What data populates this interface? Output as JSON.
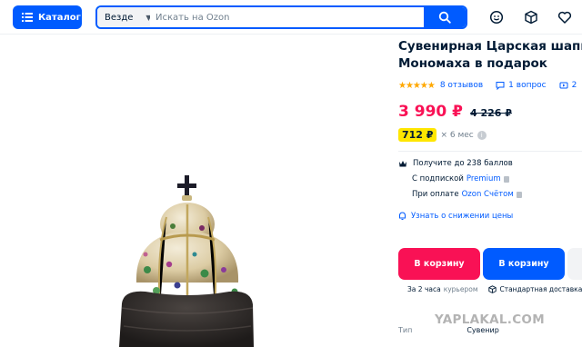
{
  "header": {
    "catalog_label": "Каталог",
    "search_scope": "Везде",
    "search_placeholder": "Искать на Ozon"
  },
  "product": {
    "title_line1": "Сувенирная Царская шапка",
    "title_line2": "Мономаха в подарок",
    "rating_stars": "★★★★★",
    "reviews": "8 отзывов",
    "questions": "1 вопрос",
    "more": "2",
    "price": "3 990 ₽",
    "old_price": "4 226 ₽",
    "installment_price": "712 ₽",
    "installment_note": "× 6 мес",
    "bonus": "Получите до 238 баллов",
    "sub_prefix": "С подпиской",
    "sub_premium": "Premium",
    "pay_prefix": "При оплате",
    "pay_account": "Ozon Счётом",
    "notify": "Узнать о снижении цены"
  },
  "actions": {
    "cart_pink": "В корзину",
    "cart_blue": "В корзину"
  },
  "delivery": {
    "courier_time": "За 2 часа",
    "courier_label": "курьером",
    "standard": "Стандартная доставка"
  },
  "spec": {
    "type_label": "Тип",
    "type_value": "Сувенир"
  },
  "watermark": "YAPLAKAL.COM",
  "colors": {
    "brand_blue": "#005bff",
    "price_pink": "#f91155",
    "install_yellow": "#ffe600",
    "stars": "#ffa800"
  }
}
